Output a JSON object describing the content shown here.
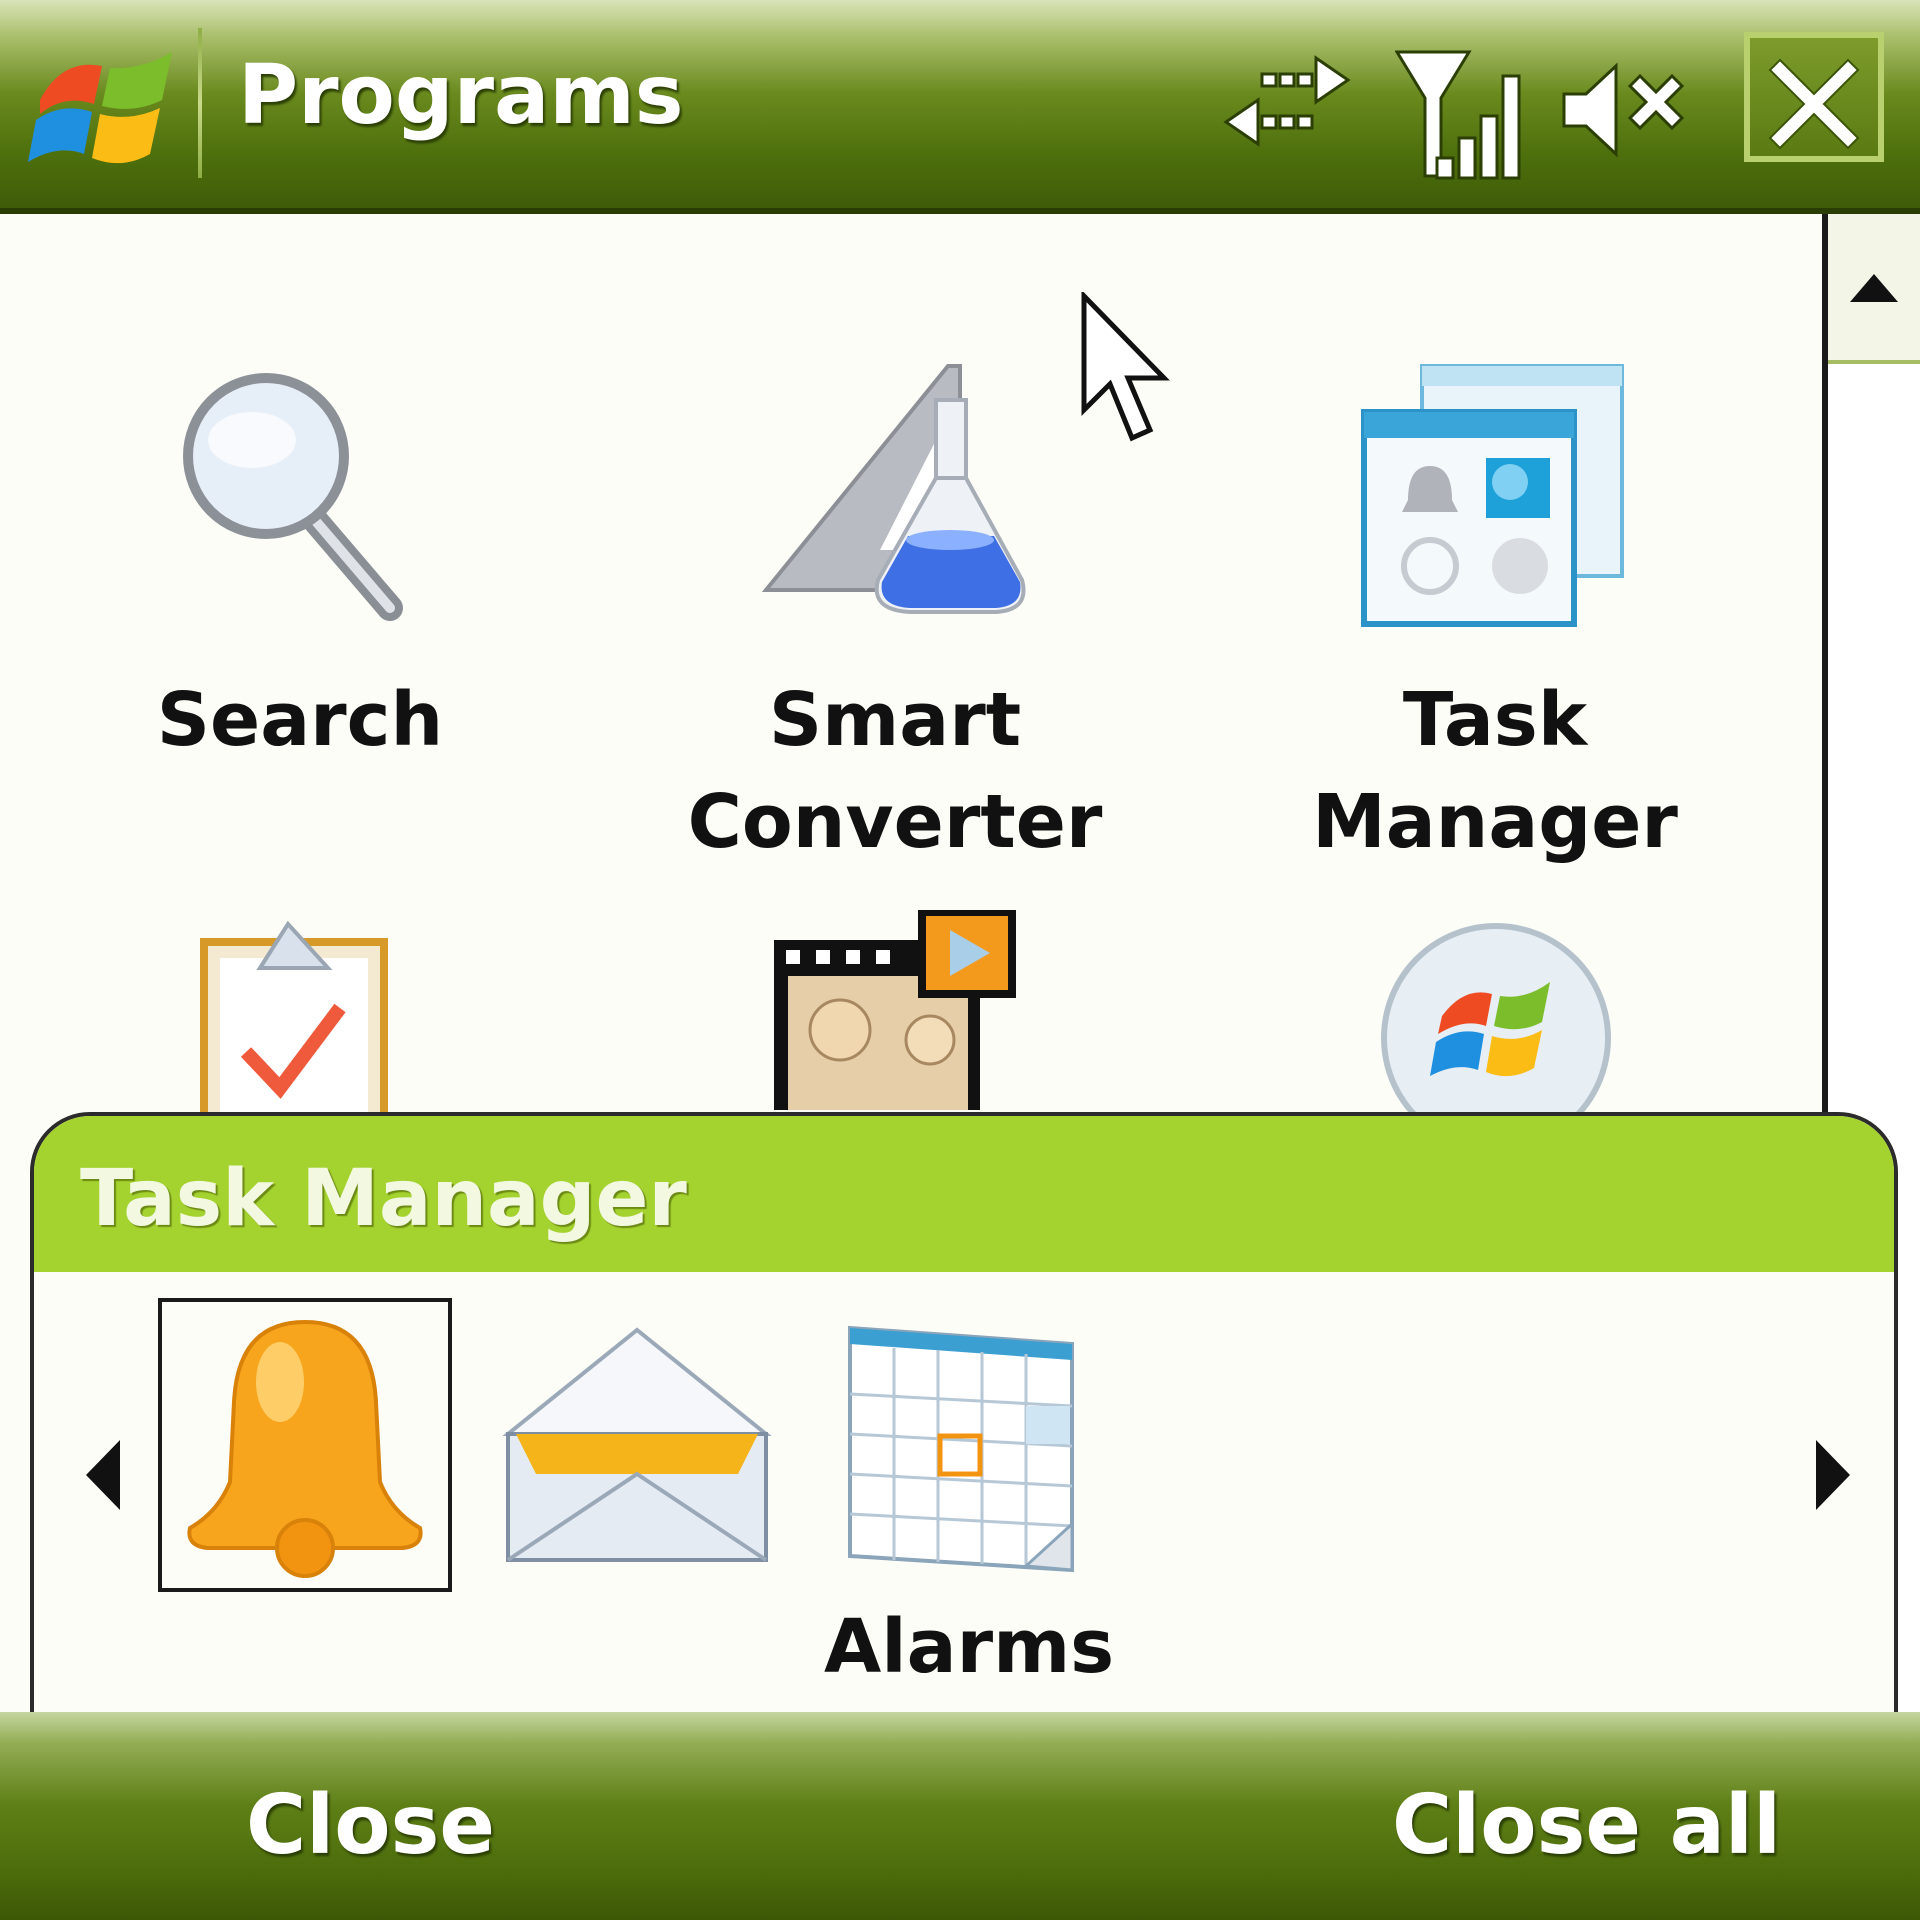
{
  "titlebar": {
    "title": "Programs",
    "icons": [
      "windows-start-icon",
      "connectivity-arrows-icon",
      "signal-strength-icon",
      "speaker-muted-icon",
      "close-icon"
    ]
  },
  "programs": [
    {
      "label_line1": "Search",
      "label_line2": "",
      "icon": "magnifier-icon"
    },
    {
      "label_line1": "Smart",
      "label_line2": "Converter",
      "icon": "flask-ruler-icon"
    },
    {
      "label_line1": "Task",
      "label_line2": "Manager",
      "icon": "task-manager-windows-icon"
    },
    {
      "icon": "clipboard-check-icon"
    },
    {
      "icon": "film-people-icon"
    },
    {
      "icon": "windows-orb-icon"
    }
  ],
  "task_manager": {
    "title": "Task Manager",
    "selected_label": "Alarms",
    "items": [
      {
        "name": "alarms",
        "icon": "bell-icon",
        "selected": true
      },
      {
        "name": "messaging",
        "icon": "envelope-icon",
        "selected": false
      },
      {
        "name": "calendar",
        "icon": "calendar-icon",
        "selected": false
      }
    ]
  },
  "softkeys": {
    "left": "Close",
    "right": "Close all"
  },
  "colors": {
    "titlebar_green": "#4d6f0c",
    "panel_header_green": "#a4d22f",
    "bell_orange": "#f7a51c"
  }
}
